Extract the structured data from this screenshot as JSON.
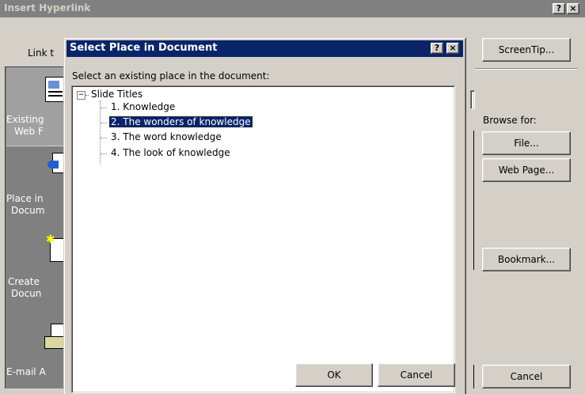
{
  "outer_dialog": {
    "title": "Insert Hyperlink",
    "help_btn": "?",
    "close_btn": "×",
    "link_to_label": "Link t",
    "screentip_btn": "ScreenTip...",
    "browse_for_label": "Browse for:",
    "file_btn": "File...",
    "web_page_btn": "Web Page...",
    "bookmark_btn": "Bookmark...",
    "cancel_btn": "Cancel",
    "places": [
      {
        "line1": "Existing",
        "line2": "Web F",
        "icon": "existing-file-icon"
      },
      {
        "line1": "Place in",
        "line2": "Docum",
        "icon": "place-in-document-icon"
      },
      {
        "line1": "Create",
        "line2": "Docun",
        "icon": "new-document-icon"
      },
      {
        "line1": "E-mail A",
        "line2": "",
        "icon": "email-icon"
      }
    ]
  },
  "dialog": {
    "title": "Select Place in Document",
    "help_btn": "?",
    "close_btn": "×",
    "instruction": "Select an existing place in the document:",
    "tree": {
      "root_label": "Slide Titles",
      "root_expander": "−",
      "items": [
        {
          "label": "1. Knowledge",
          "selected": false
        },
        {
          "label": "2. The wonders of knowledge",
          "selected": true
        },
        {
          "label": "3. The word knowledge",
          "selected": false
        },
        {
          "label": "4. The look of knowledge",
          "selected": false
        }
      ]
    },
    "ok_btn": "OK",
    "cancel_btn": "Cancel"
  },
  "colors": {
    "titlebar_active": "#0a246a",
    "titlebar_inactive": "#808080",
    "selection": "#0a246a"
  }
}
